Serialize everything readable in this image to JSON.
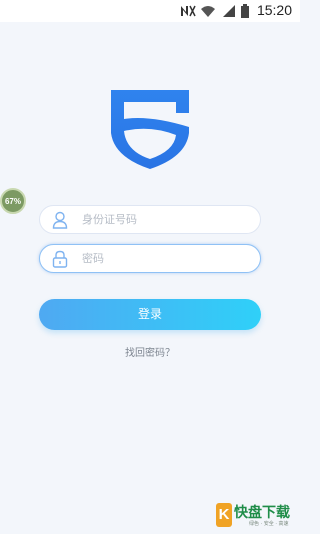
{
  "status_bar": {
    "time": "15:20",
    "icons": [
      "notification-icon",
      "wifi-icon",
      "signal-icon",
      "battery-icon"
    ]
  },
  "logo": {
    "icon": "shield-logo-icon",
    "color": "#2b7de9"
  },
  "floating_badge": {
    "text": "67%"
  },
  "form": {
    "id_field": {
      "placeholder": "身份证号码",
      "value": "",
      "icon": "user-icon"
    },
    "password_field": {
      "placeholder": "密码",
      "value": "",
      "icon": "lock-icon"
    },
    "login_label": "登录",
    "forgot_label": "找回密码？"
  },
  "watermark": {
    "k": "K",
    "title": "快盘下载",
    "sub": "绿色 · 安全 · 高速"
  },
  "colors": {
    "accent": "#3cb8f6",
    "background": "#f3f6fb",
    "logo": "#2b7de9"
  }
}
